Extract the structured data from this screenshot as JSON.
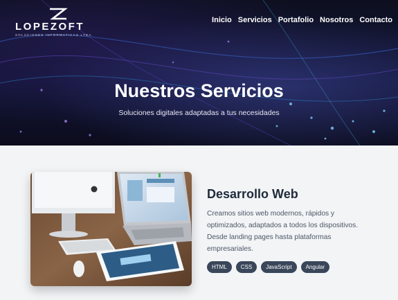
{
  "brand": {
    "name": "LOPEZOFT",
    "tagline": "SOLUCIONES INFORMATICAS LTDA."
  },
  "nav": {
    "items": [
      "Inicio",
      "Servicios",
      "Portafolio",
      "Nosotros",
      "Contacto"
    ]
  },
  "hero": {
    "title": "Nuestros Servicios",
    "subtitle": "Soluciones digitales adaptadas a tus necesidades"
  },
  "service": {
    "title": "Desarrollo Web",
    "description": "Creamos sitios web modernos, rápidos y optimizados, adaptados a todos los dispositivos. Desde landing pages hasta plataformas empresariales.",
    "tags": [
      "HTML",
      "CSS",
      "JavaScript",
      "Angular"
    ],
    "image_icon": "devices-photo-icon"
  },
  "colors": {
    "hero_bg": "#12142e",
    "tag_bg": "#3a475a",
    "title_text": "#1f2a3a",
    "page_bg": "#f2f4f6"
  }
}
